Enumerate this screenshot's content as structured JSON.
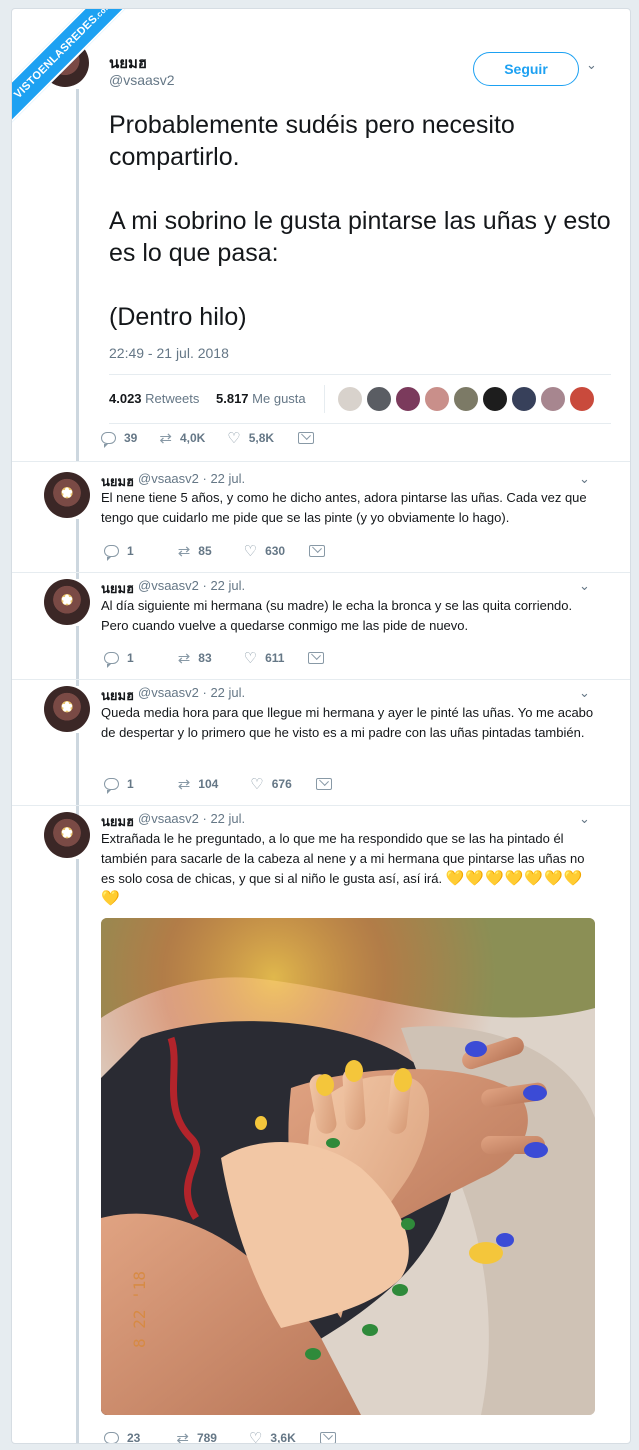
{
  "watermark": {
    "main": "VISTOENLASREDES",
    "suffix": ".com"
  },
  "header": {
    "display_name": "นยมฮ",
    "handle": "@vsaasv2",
    "follow_label": "Seguir"
  },
  "main_tweet": {
    "paragraphs": [
      "Probablemente sudéis pero necesito compartirlo.",
      "A mi sobrino le gusta pintarse las uñas y esto es lo que pasa:",
      "(Dentro hilo)"
    ],
    "timestamp": "22:49 - 21 jul. 2018",
    "retweets_count": "4.023",
    "retweets_label": "Retweets",
    "likes_count": "5.817",
    "likes_label": "Me gusta",
    "actions": {
      "replies": "39",
      "retweets": "4,0K",
      "likes": "5,8K"
    }
  },
  "replies": [
    {
      "name": "นยมฮ",
      "handle": "@vsaasv2 · 22 jul.",
      "text": "El nene tiene 5 años, y como he dicho antes, adora pintarse las uñas. Cada vez que tengo que cuidarlo me pide que se las pinte (y yo obviamente lo hago).",
      "replies": "1",
      "retweets": "85",
      "likes": "630"
    },
    {
      "name": "นยมฮ",
      "handle": "@vsaasv2 · 22 jul.",
      "text": "Al día siguiente mi hermana (su madre) le echa la bronca y se las quita corriendo. Pero cuando vuelve a quedarse conmigo me las pide de nuevo.",
      "replies": "1",
      "retweets": "83",
      "likes": "611"
    },
    {
      "name": "นยมฮ",
      "handle": "@vsaasv2 · 22 jul.",
      "text": "Queda media hora para que llegue mi hermana y ayer le pinté las uñas. Yo me acabo de despertar y lo primero que he visto es a mi padre con las uñas pintadas también.",
      "replies": "1",
      "retweets": "104",
      "likes": "676"
    },
    {
      "name": "นยมฮ",
      "handle": "@vsaasv2 · 22 jul.",
      "text": "Extrañada le he preguntado, a lo que me ha respondido que se las ha pintado él también para sacarle de la cabeza al nene y a mi hermana que pintarse las uñas no es solo cosa de chicas, y que si al niño le gusta así, así irá.",
      "emoji": "💛💛💛💛💛💛💛💛",
      "photo_stamp": "8 22 '18",
      "replies": "23",
      "retweets": "789",
      "likes": "3,6K"
    }
  ],
  "icons": {
    "reply": "reply-icon",
    "retweet": "retweet-icon",
    "like": "heart-icon",
    "message": "message-icon",
    "more": "chevron-down-icon"
  },
  "colors": {
    "accent": "#1da1f2",
    "background": "#e6ecf0",
    "muted": "#657786",
    "heart_emoji": "#f5c02b"
  }
}
